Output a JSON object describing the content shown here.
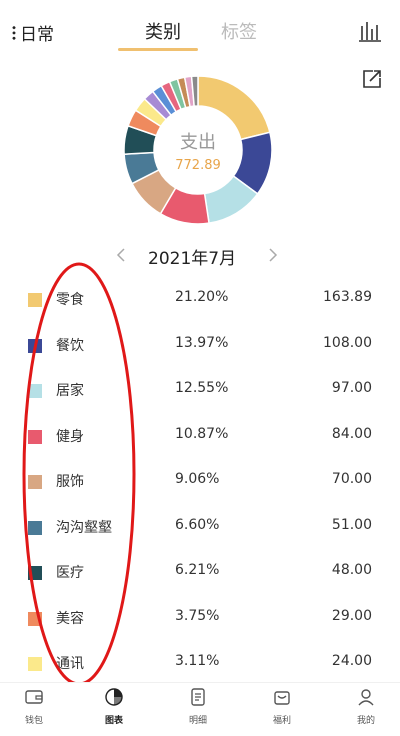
{
  "header": {
    "book_name": "日常",
    "tabs": [
      {
        "label": "类别",
        "active": true
      },
      {
        "label": "标签",
        "active": false
      }
    ],
    "chart_icon": "bar-chart-icon",
    "share_icon": "share-icon"
  },
  "summary": {
    "label": "支出",
    "total": "772.89"
  },
  "month": {
    "label": "2021年7月"
  },
  "categories": [
    {
      "name": "零食",
      "percent": "21.20%",
      "amount": "163.89",
      "color": "#f2c970"
    },
    {
      "name": "餐饮",
      "percent": "13.97%",
      "amount": "108.00",
      "color": "#3b4896"
    },
    {
      "name": "居家",
      "percent": "12.55%",
      "amount": "97.00",
      "color": "#b5e0e6"
    },
    {
      "name": "健身",
      "percent": "10.87%",
      "amount": "84.00",
      "color": "#e85a6e"
    },
    {
      "name": "服饰",
      "percent": "9.06%",
      "amount": "70.00",
      "color": "#d8a783"
    },
    {
      "name": "沟沟壑壑",
      "percent": "6.60%",
      "amount": "51.00",
      "color": "#4a7a96"
    },
    {
      "name": "医疗",
      "percent": "6.21%",
      "amount": "48.00",
      "color": "#214e57"
    },
    {
      "name": "美容",
      "percent": "3.75%",
      "amount": "29.00",
      "color": "#ef8a5e"
    },
    {
      "name": "通讯",
      "percent": "3.11%",
      "amount": "24.00",
      "color": "#fbe98b"
    }
  ],
  "chart_data": {
    "type": "pie",
    "values": [
      21.2,
      13.97,
      12.55,
      10.87,
      9.06,
      6.6,
      6.21,
      3.75,
      3.11,
      2.4,
      2.2,
      2.0,
      1.8,
      1.6,
      1.5,
      1.39
    ],
    "colors": [
      "#f2c970",
      "#3b4896",
      "#b5e0e6",
      "#e85a6e",
      "#d8a783",
      "#4a7a96",
      "#214e57",
      "#ef8a5e",
      "#fbe98b",
      "#a78bd4",
      "#5a8fd6",
      "#e6667f",
      "#7fc4a0",
      "#c58b57",
      "#e1a3c7",
      "#8a8a8a"
    ]
  },
  "bottom_nav": [
    {
      "label": "钱包",
      "icon": "wallet-icon",
      "active": false
    },
    {
      "label": "图表",
      "icon": "pie-chart-icon",
      "active": true
    },
    {
      "label": "明细",
      "icon": "list-icon",
      "active": false
    },
    {
      "label": "福利",
      "icon": "gift-icon",
      "active": false
    },
    {
      "label": "我的",
      "icon": "user-icon",
      "active": false
    }
  ],
  "annotation_color": "#e01818"
}
